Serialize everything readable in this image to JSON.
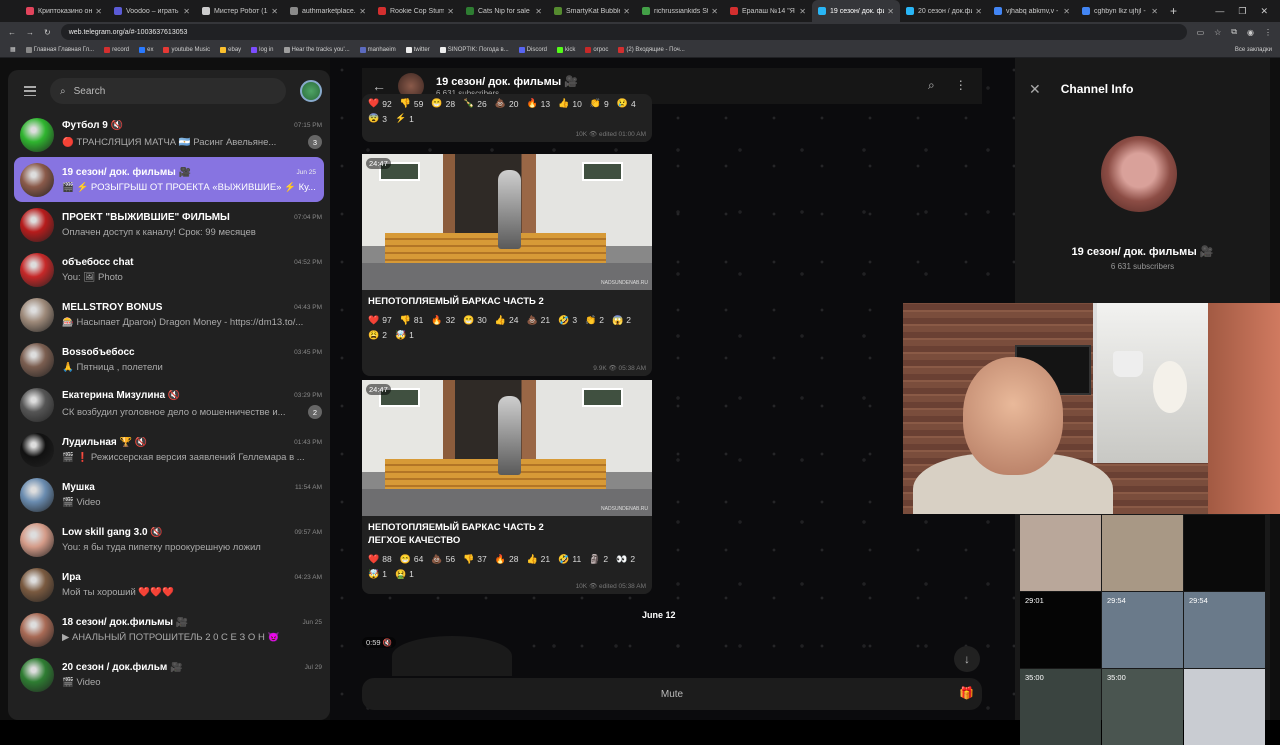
{
  "browser": {
    "tabs": [
      {
        "title": "Криптоказино онл",
        "color": "#e2445c"
      },
      {
        "title": "Voodoo – играть в",
        "color": "#5b5bd6"
      },
      {
        "title": "Мистер Робот (1-4",
        "color": "#cccccc"
      },
      {
        "title": "authmarketplace.n",
        "color": "#8a8a8a"
      },
      {
        "title": "Rookie Cop Stumbli",
        "color": "#d32f2f"
      },
      {
        "title": "Cats Nip for sale |",
        "color": "#2e7d32"
      },
      {
        "title": "SmartyKat Bubble",
        "color": "#558b2f"
      },
      {
        "title": "richrussiankids Str",
        "color": "#43a047"
      },
      {
        "title": "Ералаш №14 \"Я с",
        "color": "#d32f2f"
      },
      {
        "title": "19 сезон/ док. фи",
        "color": "#29b6f6"
      },
      {
        "title": "20 сезон / док.фил",
        "color": "#29b6f6"
      },
      {
        "title": "vjhabq abkmv,v - G",
        "color": "#4285f4"
      },
      {
        "title": "cghbyn lkz ujhjl - G",
        "color": "#4285f4"
      }
    ],
    "active_tab": 9,
    "url": "web.telegram.org/a/#-1003637613053",
    "bookmarks": [
      "Главная Главная Гл...",
      "record",
      "ex",
      "youtube Music",
      "ebay",
      "log in",
      "Hear the tracks you'...",
      "manhaeim",
      "twitter",
      "SINOPTIK: Погода в...",
      "Discord",
      "kick",
      "orpoc",
      "(2) Входящие - Поч..."
    ],
    "bookmarks_right": "Все закладки"
  },
  "sidebar": {
    "search_placeholder": "Search",
    "chats": [
      {
        "name": "Футбол 9 🔇",
        "time": "07:15 PM",
        "msg": "🔴 ТРАНСЛЯЦИЯ МАТЧА 🇦🇷 Расинг Авельяне...",
        "badge": "3",
        "color": "#2fb52f"
      },
      {
        "name": "19 сезон/ док. фильмы 🎥",
        "time": "Jun 25",
        "msg": "🎬 ⚡ РОЗЫГРЫШ ОТ ПРОЕКТА «ВЫЖИВШИЕ» ⚡ Ку...",
        "badge": "",
        "color": "#8a5a4a"
      },
      {
        "name": "ПРОЕКТ \"ВЫЖИВШИЕ\" ФИЛЬМЫ",
        "time": "07:04 PM",
        "msg": "Оплачен доступ к каналу! Срок: 99 месяцев",
        "badge": "",
        "color": "#b71c1c"
      },
      {
        "name": "объебосс chat",
        "time": "04:52 PM",
        "msg": "You: 🖼 Photo",
        "badge": "",
        "color": "#c62828"
      },
      {
        "name": "MELLSTROY BONUS",
        "time": "04:43 PM",
        "msg": "🎰 Насыпает Драгон) Dragon Money - https://dm13.to/...",
        "badge": "",
        "color": "#9e8a7a"
      },
      {
        "name": "Bossобъебосс",
        "time": "03:45 PM",
        "msg": "🙏 Пятница , полетели",
        "badge": "",
        "color": "#7b5e50"
      },
      {
        "name": "Екатерина Мизулина 🔇",
        "time": "03:29 PM",
        "msg": "СК возбудил уголовное дело о мошенничестве и...",
        "badge": "2",
        "color": "#555555"
      },
      {
        "name": "Лудильная 🏆 🔇",
        "time": "01:43 PM",
        "msg": "🎬 ❗ Режиссерская версия заявлений Геллемара в ...",
        "badge": "",
        "color": "#111111"
      },
      {
        "name": "Мушка",
        "time": "11:54 AM",
        "msg": "🎬 Video",
        "badge": "",
        "color": "#6a8cb0"
      },
      {
        "name": "Low skill gang 3.0 🔇",
        "time": "09:57 AM",
        "msg": "You: я бы туда пипетку проокурешную ложил",
        "badge": "",
        "color": "#d49b88"
      },
      {
        "name": "Ира",
        "time": "04:23 AM",
        "msg": "Мой ты хороший ❤️❤️❤️",
        "badge": "",
        "color": "#7a5a40"
      },
      {
        "name": "18 сезон/ док.фильмы 🎥",
        "time": "Jun 25",
        "msg": "▶ АНАЛЬНЫЙ ПОТРОШИТЕЛЬ 2 0 С Е З О Н 😈",
        "badge": "",
        "color": "#a86a55"
      },
      {
        "name": "20 сезон / док.фильм 🎥",
        "time": "Jul 29",
        "msg": "🎬 Video",
        "badge": "",
        "color": "#2e7d32"
      }
    ]
  },
  "channel": {
    "title": "19 сезон/ док. фильмы 🎥",
    "subscribers": "6,631 subscribers",
    "mute_label": "Mute",
    "date_divider": "June 12"
  },
  "messages": [
    {
      "reactions": [
        [
          "❤️",
          "92"
        ],
        [
          "👎",
          "59"
        ],
        [
          "😁",
          "28"
        ],
        [
          "🍾",
          "26"
        ],
        [
          "💩",
          "20"
        ],
        [
          "🔥",
          "13"
        ],
        [
          "👍",
          "10"
        ],
        [
          "👏",
          "9"
        ],
        [
          "😢",
          "4"
        ],
        [
          "😨",
          "3"
        ],
        [
          "⚡",
          "1"
        ]
      ],
      "views": "10K",
      "time": "edited 01:00 AM"
    },
    {
      "duration": "24:47",
      "watermark": "NADSUNDENAB.RU",
      "caption": "НЕПОТОПЛЯЕМЫЙ БАРКАС ЧАСТЬ 2",
      "reactions": [
        [
          "❤️",
          "97"
        ],
        [
          "👎",
          "81"
        ],
        [
          "🔥",
          "32"
        ],
        [
          "😁",
          "30"
        ],
        [
          "👍",
          "24"
        ],
        [
          "💩",
          "21"
        ],
        [
          "🤣",
          "3"
        ],
        [
          "👏",
          "2"
        ],
        [
          "😱",
          "2"
        ],
        [
          "😩",
          "2"
        ],
        [
          "🤯",
          "1"
        ]
      ],
      "views": "9.9K",
      "time": "05:38 AM"
    },
    {
      "duration": "24:47",
      "watermark": "NADSUNDENAB.RU",
      "caption": "НЕПОТОПЛЯЕМЫЙ БАРКАС ЧАСТЬ 2\nЛЕГХОЕ КАЧЕСТВО",
      "reactions": [
        [
          "❤️",
          "88"
        ],
        [
          "😁",
          "64"
        ],
        [
          "💩",
          "56"
        ],
        [
          "👎",
          "37"
        ],
        [
          "🔥",
          "28"
        ],
        [
          "👍",
          "21"
        ],
        [
          "🤣",
          "11"
        ],
        [
          "🗿",
          "2"
        ],
        [
          "👀",
          "2"
        ],
        [
          "🤯",
          "1"
        ],
        [
          "🤮",
          "1"
        ]
      ],
      "views": "10K",
      "time": "edited 05:38 AM"
    }
  ],
  "voice_note": {
    "duration": "0:59"
  },
  "info_panel": {
    "title": "Channel Info",
    "name": "19 сезон/ док. фильмы 🎥",
    "subscribers": "6 631 subscribers",
    "media": [
      {
        "duration": "",
        "color": "#b9a79a"
      },
      {
        "duration": "",
        "color": "#a89885"
      },
      {
        "duration": "",
        "color": "#0a0a0a"
      },
      {
        "duration": "29:01",
        "color": "#050505"
      },
      {
        "duration": "29:54",
        "color": "#6a7a8a"
      },
      {
        "duration": "29:54",
        "color": "#6a7a8a"
      },
      {
        "duration": "35:00",
        "color": "#3a4440"
      },
      {
        "duration": "35:00",
        "color": "#4a5550"
      },
      {
        "duration": "",
        "color": "#c9ccd2"
      }
    ]
  }
}
